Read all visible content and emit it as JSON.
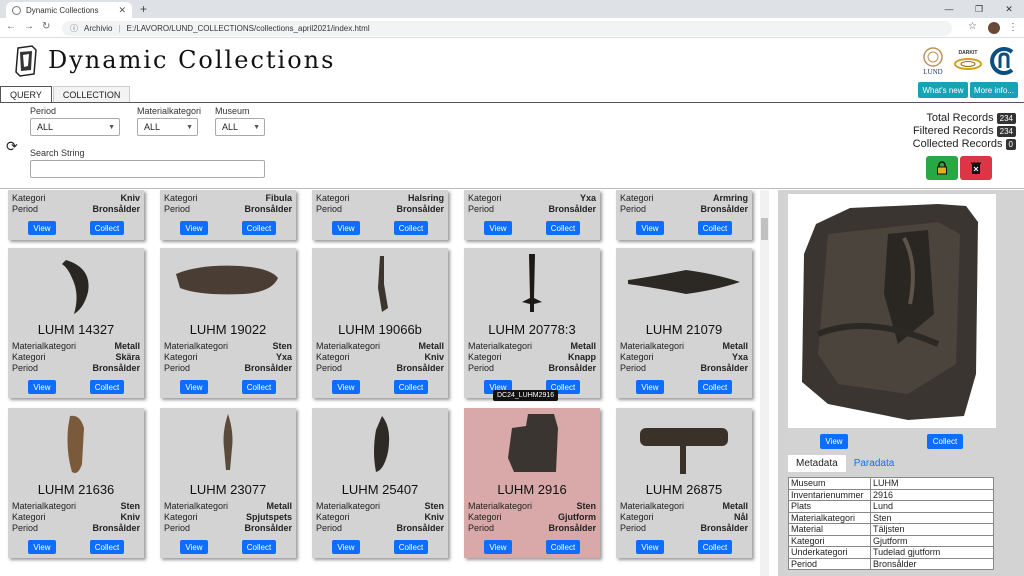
{
  "browser": {
    "tab_title": "Dynamic Collections",
    "address_info": "Archivio",
    "url": "E:/LAVORO/LUND_COLLECTIONS/collections_april2021/index.html"
  },
  "app": {
    "title": "Dynamic Collections",
    "whats_new": "What's new",
    "more_info": "More info...",
    "lund_logo_text": "LUND",
    "darkit_logo_text": "DARKIT"
  },
  "tabs": [
    "QUERY",
    "COLLECTION"
  ],
  "query": {
    "period_label": "Period",
    "period_value": "ALL",
    "material_label": "Materialkategori",
    "material_value": "ALL",
    "museum_label": "Museum",
    "museum_value": "ALL",
    "search_label": "Search String",
    "search_value": ""
  },
  "stats": {
    "total_label": "Total Records",
    "total": "234",
    "filtered_label": "Filtered Records",
    "filtered": "234",
    "collected_label": "Collected Records",
    "collected": "0"
  },
  "labels": {
    "material": "Materialkategori",
    "kategori": "Kategori",
    "period": "Period",
    "view": "View",
    "collect": "Collect"
  },
  "top_row": [
    {
      "kategori": "Kniv",
      "period": "Bronsålder"
    },
    {
      "kategori": "Fibula",
      "period": "Bronsålder"
    },
    {
      "kategori": "Halsring",
      "period": "Bronsålder"
    },
    {
      "kategori": "Yxa",
      "period": "Bronsålder"
    },
    {
      "kategori": "Armring",
      "period": "Bronsålder"
    }
  ],
  "row2": [
    {
      "id": "LUHM 14327",
      "material": "Metall",
      "kategori": "Skära",
      "period": "Bronsålder"
    },
    {
      "id": "LUHM 19022",
      "material": "Sten",
      "kategori": "Yxa",
      "period": "Bronsålder"
    },
    {
      "id": "LUHM 19066b",
      "material": "Metall",
      "kategori": "Kniv",
      "period": "Bronsålder"
    },
    {
      "id": "LUHM 20778:3",
      "material": "Metall",
      "kategori": "Knapp",
      "period": "Bronsålder"
    },
    {
      "id": "LUHM 21079",
      "material": "Metall",
      "kategori": "Yxa",
      "period": "Bronsålder"
    }
  ],
  "row3": [
    {
      "id": "LUHM 21636",
      "material": "Sten",
      "kategori": "Kniv",
      "period": "Bronsålder"
    },
    {
      "id": "LUHM 23077",
      "material": "Metall",
      "kategori": "Spjutspets",
      "period": "Bronsålder"
    },
    {
      "id": "LUHM 25407",
      "material": "Sten",
      "kategori": "Kniv",
      "period": "Bronsålder"
    },
    {
      "id": "LUHM 2916",
      "material": "Sten",
      "kategori": "Gjutform",
      "period": "Bronsålder"
    },
    {
      "id": "LUHM 26875",
      "material": "Metall",
      "kategori": "Nål",
      "period": "Bronsålder"
    }
  ],
  "tooltip": "DC24_LUHM2916",
  "detail": {
    "view": "View",
    "collect": "Collect",
    "tab_metadata": "Metadata",
    "tab_paradata": "Paradata",
    "rows": [
      {
        "k": "Museum",
        "v": "LUHM"
      },
      {
        "k": "Inventarienummer",
        "v": "2916"
      },
      {
        "k": "Plats",
        "v": "Lund"
      },
      {
        "k": "Materialkategori",
        "v": "Sten"
      },
      {
        "k": "Material",
        "v": "Täljsten"
      },
      {
        "k": "Kategori",
        "v": "Gjutform"
      },
      {
        "k": "Underkategori",
        "v": "Tudelad gjutform"
      },
      {
        "k": "Period",
        "v": "Bronsålder"
      }
    ]
  },
  "colors": {
    "teal": "#17a2b8",
    "primary": "#0d6efd",
    "success": "#28a745",
    "danger": "#dc3545",
    "card": "#d3d3d3",
    "highlight": "#d9a9a9"
  }
}
